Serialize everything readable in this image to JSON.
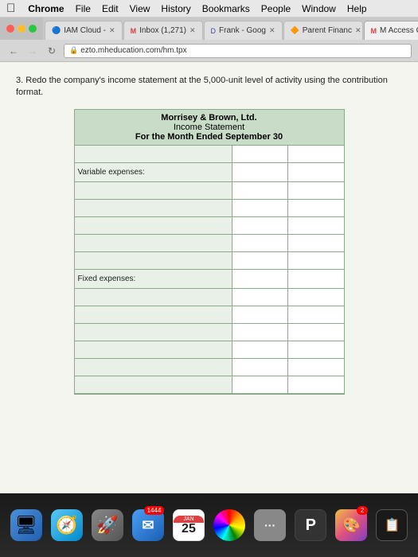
{
  "menubar": {
    "apple": "⌘",
    "items": [
      "Chrome",
      "File",
      "Edit",
      "View",
      "History",
      "Bookmarks",
      "People",
      "Window",
      "Help"
    ]
  },
  "tabs": [
    {
      "id": "tab1",
      "label": "IAM Cloud -",
      "icon": "🔵",
      "active": false,
      "closable": true
    },
    {
      "id": "tab2",
      "label": "Inbox (1,271)",
      "icon": "M",
      "active": false,
      "closable": true
    },
    {
      "id": "tab3",
      "label": "Frank - Goog",
      "icon": "D",
      "active": false,
      "closable": true
    },
    {
      "id": "tab4",
      "label": "Parent Financ",
      "icon": "🔶",
      "active": false,
      "closable": true
    },
    {
      "id": "tab5",
      "label": "M Access Conn",
      "icon": "M",
      "active": true,
      "closable": true
    }
  ],
  "nav": {
    "url": "ezto.mheducation.com/hm.tpx",
    "back_disabled": false,
    "forward_disabled": true
  },
  "question": {
    "number": "3.",
    "text": "Redo the company's income statement at the 5,000-unit level of activity using the contribution format."
  },
  "statement": {
    "company": "Morrisey & Brown, Ltd.",
    "title": "Income Statement",
    "period": "For the Month Ended September 30",
    "sections": [
      {
        "label": "Variable expenses:",
        "is_section": true
      },
      {
        "label": "",
        "is_section": false
      },
      {
        "label": "",
        "is_section": false
      },
      {
        "label": "",
        "is_section": false
      },
      {
        "label": "",
        "is_section": false
      },
      {
        "label": "",
        "is_section": false
      },
      {
        "label": "Fixed expenses:",
        "is_section": true
      },
      {
        "label": "",
        "is_section": false
      },
      {
        "label": "",
        "is_section": false
      },
      {
        "label": "",
        "is_section": false
      },
      {
        "label": "",
        "is_section": false
      },
      {
        "label": "",
        "is_section": false
      },
      {
        "label": "",
        "is_section": false
      }
    ]
  },
  "dock": {
    "items": [
      {
        "id": "finder",
        "emoji": "😊",
        "bg": "finder-icon",
        "label": "",
        "badge": ""
      },
      {
        "id": "safari",
        "emoji": "🧭",
        "bg": "safari-icon",
        "label": "",
        "badge": ""
      },
      {
        "id": "launchpad",
        "emoji": "🚀",
        "bg": "rocket-icon",
        "label": "",
        "badge": ""
      },
      {
        "id": "mail",
        "emoji": "✉️",
        "bg": "mail-icon",
        "label": "1444",
        "badge": "1444"
      },
      {
        "id": "calendar",
        "emoji": "25",
        "bg": "calendar-icon",
        "label": "",
        "badge": ""
      },
      {
        "id": "photos",
        "emoji": "🌸",
        "bg": "photo-icon",
        "label": "",
        "badge": ""
      },
      {
        "id": "dots",
        "emoji": "•••",
        "bg": "dots-icon",
        "label": "",
        "badge": ""
      },
      {
        "id": "app1",
        "emoji": "P",
        "bg": "app-icon-dark",
        "label": "",
        "badge": ""
      },
      {
        "id": "app2",
        "emoji": "🎨",
        "bg": "photo-icon",
        "label": "",
        "badge": "2"
      },
      {
        "id": "app3",
        "emoji": "📝",
        "bg": "app-icon-dark",
        "label": "",
        "badge": ""
      }
    ]
  }
}
